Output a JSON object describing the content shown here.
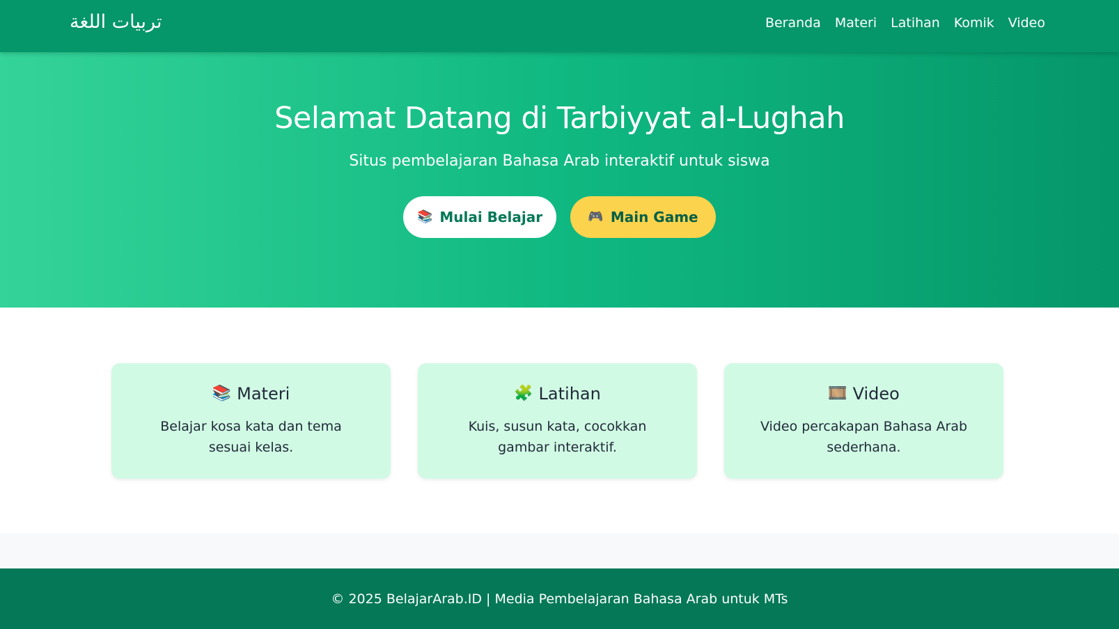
{
  "header": {
    "logo": "تربيات اللغة",
    "nav": [
      "Beranda",
      "Materi",
      "Latihan",
      "Komik",
      "Video"
    ]
  },
  "hero": {
    "title": "Selamat Datang di Tarbiyyat al-Lughah",
    "subtitle": "Situs pembelajaran Bahasa Arab interaktif untuk siswa",
    "buttons": [
      {
        "label": "Mulai Belajar",
        "icon": "books-icon",
        "glyph": "📚",
        "color": "#ffffff"
      },
      {
        "label": "Main Game",
        "icon": "game-controller-icon",
        "glyph": "🎮",
        "color": "#fcd34d"
      }
    ]
  },
  "features": [
    {
      "icon": "books-icon",
      "glyph": "📚",
      "title": "Materi",
      "description": "Belajar kosa kata dan tema sesuai kelas."
    },
    {
      "icon": "puzzle-icon",
      "glyph": "🧩",
      "title": "Latihan",
      "description": "Kuis, susun kata, cocokkan gambar interaktif."
    },
    {
      "icon": "film-icon",
      "glyph": "🎞️",
      "title": "Video",
      "description": "Video percakapan Bahasa Arab sederhana."
    }
  ],
  "footer": {
    "text": "© 2025 BelajarArab.ID | Media Pembelajaran Bahasa Arab untuk MTs"
  },
  "colors": {
    "nav_bg": "#059669",
    "hero_gradient_start": "#34d399",
    "hero_gradient_end": "#059669",
    "card_bg": "#d1fae5",
    "accent_yellow": "#fcd34d",
    "footer_bg": "#047857"
  }
}
